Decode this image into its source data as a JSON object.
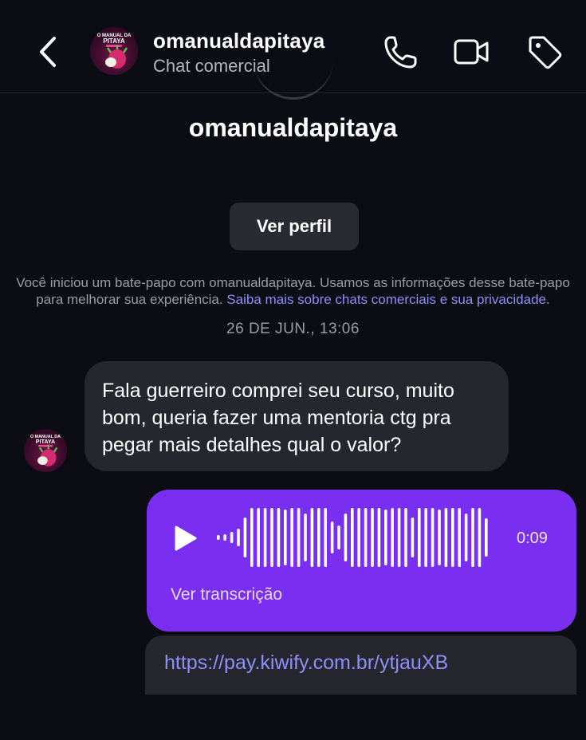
{
  "header": {
    "name": "omanualdapitaya",
    "subtitle": "Chat comercial",
    "avatar_text": [
      "O MANUAL DA",
      "PITAYA"
    ]
  },
  "icons": {
    "back": "chevron-left-icon",
    "phone": "phone-icon",
    "video": "video-camera-icon",
    "tag": "tag-icon",
    "play": "play-icon"
  },
  "profile": {
    "name": "omanualdapitaya",
    "view_profile_label": "Ver perfil"
  },
  "notice": {
    "text": "Você iniciou um bate-papo com omanualdapitaya. Usamos as informações desse bate-papo para melhorar sua experiência. ",
    "link": "Saiba mais sobre chats comerciais e sua privacidade",
    "end": "."
  },
  "timestamp": "26 DE JUN., 13:06",
  "messages": {
    "incoming_text": "Fala guerreiro comprei seu curso, muito bom, queria fazer uma mentoria ctg pra pegar mais detalhes qual o valor?",
    "audio_duration": "0:09",
    "transcript_label": "Ver transcrição",
    "link_text": "https://pay.kiwify.com.br/ytjauXB"
  },
  "colors": {
    "background": "#0c0d14",
    "bubble_incoming": "#26272e",
    "bubble_outgoing": "#7a2ff0",
    "link": "#8e8ff7"
  }
}
